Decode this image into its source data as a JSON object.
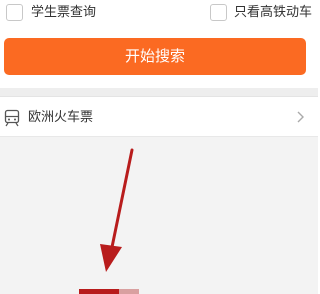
{
  "options": {
    "student_ticket_label": "学生票查询",
    "high_speed_only_label": "只看高铁动车"
  },
  "search_button": {
    "label": "开始搜索",
    "color": "#fb6a22"
  },
  "europe_row": {
    "label": "欧洲火车票",
    "icon": "train-icon"
  },
  "annotation": {
    "arrow_color": "#b81c1c"
  }
}
